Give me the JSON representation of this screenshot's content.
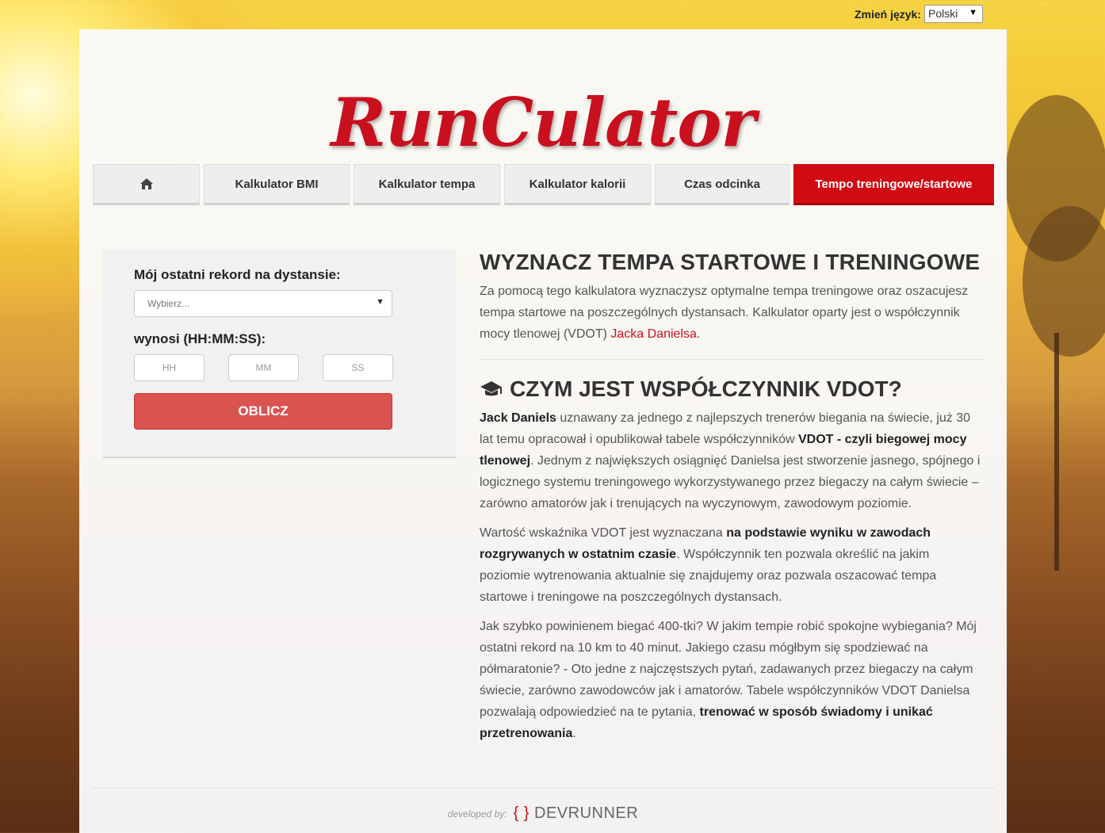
{
  "language": {
    "label": "Zmień język:",
    "selected": "Polski"
  },
  "logo": {
    "text": "RunCulator"
  },
  "nav": {
    "items": [
      {
        "label": ""
      },
      {
        "label": "Kalkulator BMI"
      },
      {
        "label": "Kalkulator tempa"
      },
      {
        "label": "Kalkulator kalorii"
      },
      {
        "label": "Czas odcinka"
      },
      {
        "label": "Tempo treningowe/startowe"
      }
    ],
    "active_color": "#d10b14"
  },
  "calculator": {
    "distance_label": "Mój ostatni rekord na dystansie:",
    "distance_placeholder": "Wybierz...",
    "time_label": "wynosi (HH:MM:SS):",
    "hh_placeholder": "HH",
    "mm_placeholder": "MM",
    "ss_placeholder": "SS",
    "submit_label": "OBLICZ"
  },
  "content": {
    "heading": "WYZNACZ TEMPA STARTOWE I TRENINGOWE",
    "intro_text": "Za pomocą tego kalkulatora wyznaczysz optymalne tempa treningowe oraz oszacujesz tempa startowe na poszczególnych dystansach. Kalkulator oparty jest o współczynnik mocy tlenowej (VDOT) ",
    "intro_link": "Jacka Danielsa",
    "intro_end": ".",
    "section_heading": "CZYM JEST WSPÓŁCZYNNIK VDOT?",
    "p1": {
      "b1": "Jack Daniels",
      "t1": " uznawany za jednego z najlepszych trenerów biegania na świecie, już 30 lat temu opracował i opublikował tabele współczynników ",
      "b2": "VDOT - czyli biegowej mocy tlenowej",
      "t2": ". Jednym z największych osiągnięć Danielsa jest stworzenie jasnego, spójnego i logicznego systemu treningowego wykorzystywanego przez biegaczy na całym świecie – zarówno amatorów jak i trenujących na wyczynowym, zawodowym poziomie."
    },
    "p2": {
      "t1": "Wartość wskaźnika VDOT jest wyznaczana ",
      "b1": "na podstawie wyniku w zawodach rozgrywanych w ostatnim czasie",
      "t2": ". Współczynnik ten pozwala określić na jakim poziomie wytrenowania aktualnie się znajdujemy oraz pozwala oszacować tempa startowe i treningowe na poszczególnych dystansach."
    },
    "p3": {
      "t1": "Jak szybko powinienem biegać 400-tki? W jakim tempie robić spokojne wybiegania? Mój ostatni rekord na 10 km to 40 minut. Jakiego czasu mógłbym się spodziewać na półmaratonie? - Oto jedne z najczęstszych pytań, zadawanych przez biegaczy na całym świecie, zarówno zawodowców jak i amatorów. Tabele współczynników VDOT Danielsa pozwalają odpowiedzieć na te pytania, ",
      "b1": "trenować w sposób świadomy i unikać przetrenowania",
      "t2": "."
    }
  },
  "footer": {
    "developed_by": "developed by:",
    "brand_braces": "{ }",
    "brand": "DEVRUNNER"
  }
}
